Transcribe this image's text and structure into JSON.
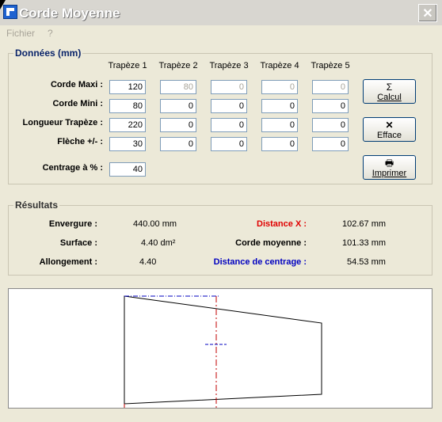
{
  "window": {
    "title": "Corde Moyenne",
    "close_glyph": "✕"
  },
  "menu": [
    {
      "label": "Fichier"
    },
    {
      "label": "?"
    }
  ],
  "donnees": {
    "legend": "Données (mm)",
    "columns": [
      "Trapèze 1",
      "Trapèze 2",
      "Trapèze 3",
      "Trapèze 4",
      "Trapèze 5"
    ],
    "rows": [
      {
        "label": "Corde Maxi :",
        "values": [
          "120",
          "80",
          "0",
          "0",
          "0"
        ]
      },
      {
        "label": "Corde Mini :",
        "values": [
          "80",
          "0",
          "0",
          "0",
          "0"
        ]
      },
      {
        "label": "Longueur Trapèze :",
        "values": [
          "220",
          "0",
          "0",
          "0",
          "0"
        ]
      },
      {
        "label": "Flèche  +/- :",
        "values": [
          "30",
          "0",
          "0",
          "0",
          "0"
        ]
      }
    ],
    "centrage_label": "Centrage à % :",
    "centrage_value": "40"
  },
  "buttons": {
    "calcul": {
      "label": "Calcul",
      "icon": "sigma-icon",
      "glyph": "Σ"
    },
    "efface": {
      "label": "Efface",
      "icon": "x-icon",
      "glyph": "✕"
    },
    "imprimer": {
      "label": "Imprimer",
      "icon": "printer-icon",
      "glyph": "🖶"
    }
  },
  "resultats": {
    "legend": "Résultats",
    "envergure_label": "Envergure :",
    "envergure_value": "440.00 mm",
    "surface_label": "Surface :",
    "surface_value": "4.40 dm²",
    "allongement_label": "Allongement :",
    "allongement_value": "4.40",
    "distance_x_label": "Distance X :",
    "distance_x_value": "102.67 mm",
    "corde_moyenne_label": "Corde moyenne :",
    "corde_moyenne_value": "101.33 mm",
    "distance_centrage_label": "Distance de centrage :",
    "distance_centrage_value": "54.53 mm"
  },
  "colors": {
    "distance_x": "#e00000",
    "distance_centrage": "#0000c0",
    "axis_line": "#c00000",
    "chord_line": "#0000c0"
  }
}
